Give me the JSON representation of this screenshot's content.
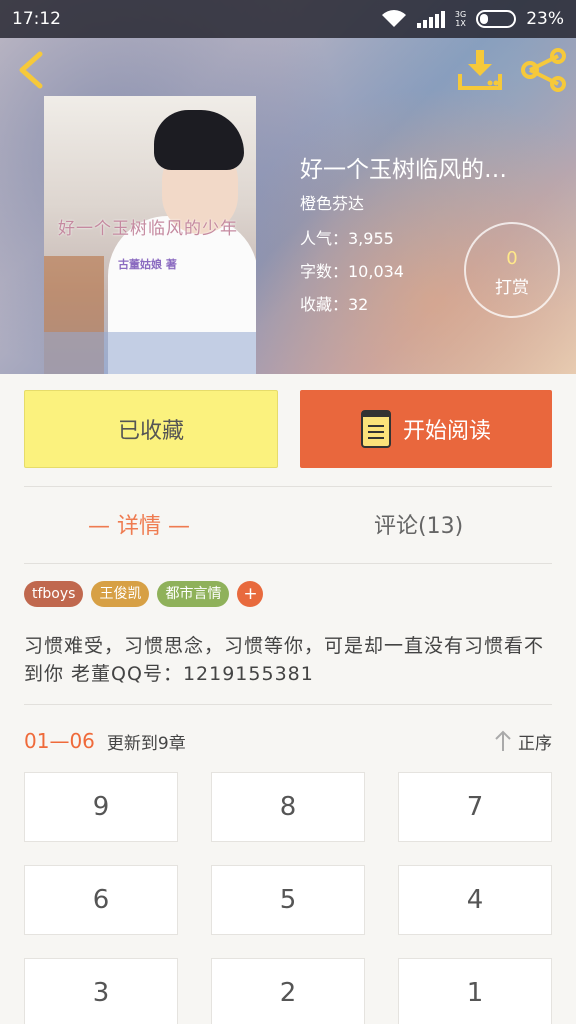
{
  "status": {
    "time": "17:12",
    "network": "3G",
    "sim": "1X",
    "battery": "23%"
  },
  "icons": {
    "back": "chevron-left-icon",
    "download": "download-icon",
    "share": "share-icon",
    "read_button_icon": "book-icon",
    "sort": "arrow-up-icon"
  },
  "cover": {
    "title": "好一个玉树临风的少年",
    "author": "古董姑娘 著"
  },
  "book": {
    "title": "好一个玉树临风的…",
    "author": "橙色芬达",
    "popularity": "人气：3,955",
    "words": "字数：10,034",
    "favorites": "收藏：32"
  },
  "reward": {
    "count": "0",
    "label": "打赏"
  },
  "actions": {
    "collect_label": "已收藏",
    "read_label": "开始阅读"
  },
  "tabs": {
    "detail": "— 详情 —",
    "comment": "评论(13)"
  },
  "tags": [
    {
      "label": "tfboys",
      "color": "#c0684e"
    },
    {
      "label": "王俊凯",
      "color": "#d7a045"
    },
    {
      "label": "都市言情",
      "color": "#8fb15a"
    },
    {
      "label": "+",
      "color": "#e86a3d"
    }
  ],
  "description": "习惯难受，习惯思念，习惯等你，可是却一直没有习惯看不到你 老董QQ号：1219155381",
  "chapters": {
    "range": "01—06",
    "updated": "更新到9章",
    "sort_label": "正序",
    "items": [
      "9",
      "8",
      "7",
      "6",
      "5",
      "4",
      "3",
      "2",
      "1"
    ]
  },
  "colors": {
    "accent": "#e9673d",
    "collect": "#fbf27e"
  }
}
